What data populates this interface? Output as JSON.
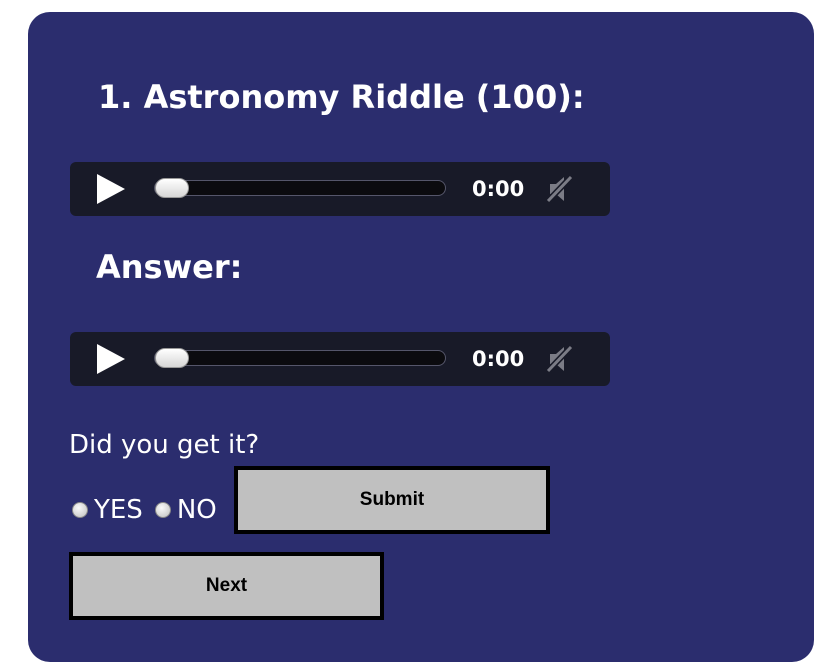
{
  "quiz": {
    "title": "1. Astronomy Riddle (100):",
    "answer_heading": "Answer:",
    "question": "Did you get it?",
    "options": [
      {
        "label": "YES",
        "selected": false
      },
      {
        "label": "NO",
        "selected": false
      }
    ],
    "submit_label": "Submit",
    "next_label": "Next"
  },
  "players": [
    {
      "time": "0:00",
      "progress": 0,
      "muted": true,
      "icons": {
        "play": "play-icon",
        "mute": "muted-speaker-icon"
      }
    },
    {
      "time": "0:00",
      "progress": 0,
      "muted": true,
      "icons": {
        "play": "play-icon",
        "mute": "muted-speaker-icon"
      }
    }
  ],
  "colors": {
    "panel_bg": "#2b2d6e",
    "player_bg": "#181a28",
    "button_bg": "#c0c0c0",
    "text": "#ffffff"
  }
}
